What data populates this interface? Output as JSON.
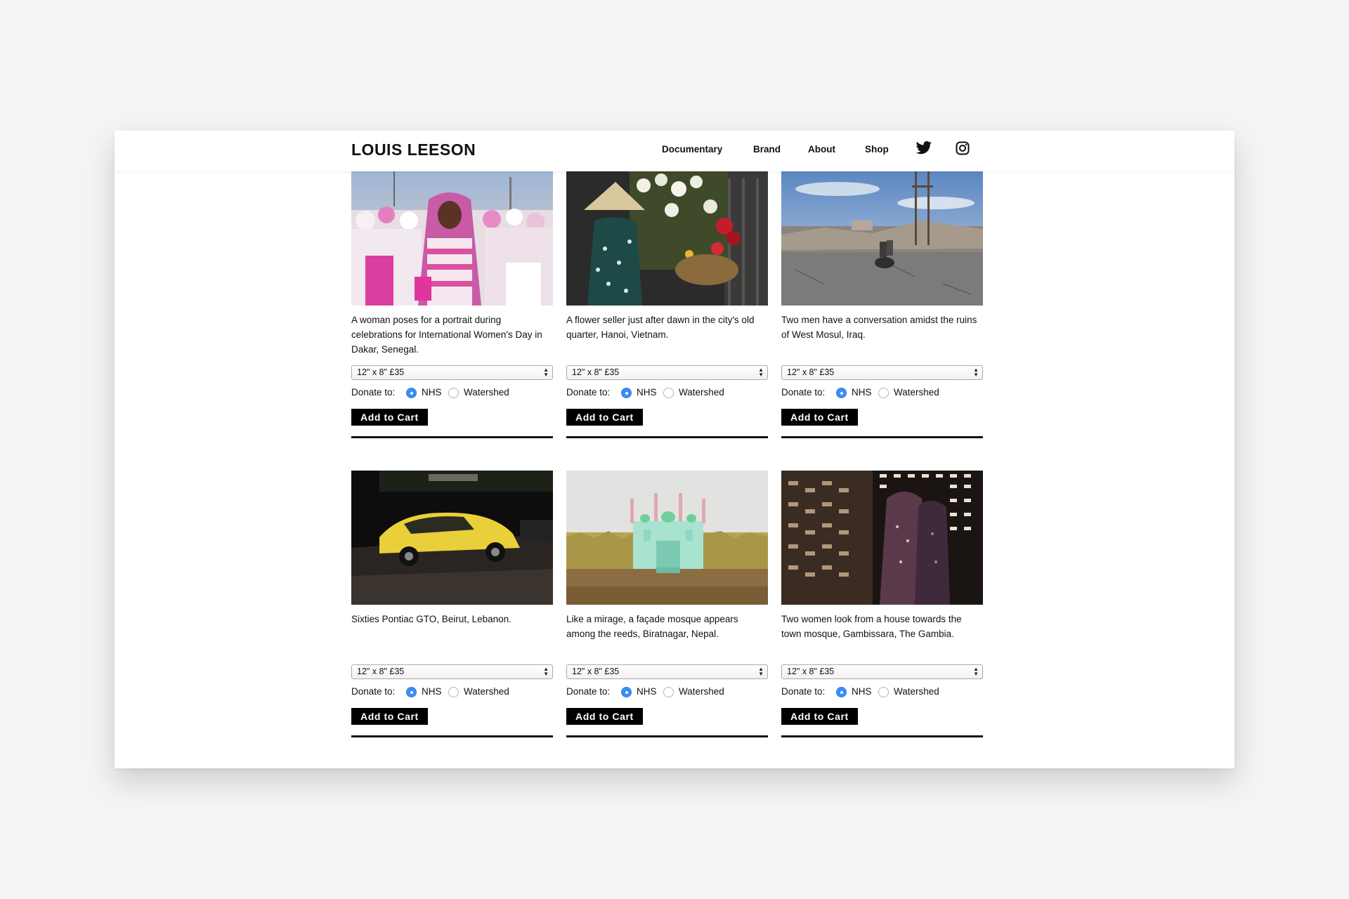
{
  "site": {
    "logo": "LOUIS LEESON"
  },
  "nav": {
    "items": [
      {
        "label": "Documentary"
      },
      {
        "label": "Brand"
      },
      {
        "label": "About"
      },
      {
        "label": "Shop"
      }
    ],
    "icons": [
      "twitter-icon",
      "instagram-icon"
    ]
  },
  "products": [
    {
      "caption": "A woman poses for a portrait during celebrations for International Women's Day in Dakar, Senegal.",
      "size_option": "12\" x 8\" £35",
      "donate_label": "Donate to:",
      "charities": [
        "NHS",
        "Watershed"
      ],
      "selected_charity": "NHS",
      "cart_label": "Add to Cart"
    },
    {
      "caption": "A flower seller just after dawn in the city's old quarter, Hanoi, Vietnam.",
      "size_option": "12\" x 8\" £35",
      "donate_label": "Donate to:",
      "charities": [
        "NHS",
        "Watershed"
      ],
      "selected_charity": "NHS",
      "cart_label": "Add to Cart"
    },
    {
      "caption": "Two men have a conversation amidst the ruins of West Mosul, Iraq.",
      "size_option": "12\" x 8\" £35",
      "donate_label": "Donate to:",
      "charities": [
        "NHS",
        "Watershed"
      ],
      "selected_charity": "NHS",
      "cart_label": "Add to Cart"
    },
    {
      "caption": "Sixties Pontiac GTO, Beirut, Lebanon.",
      "size_option": "12\" x 8\" £35",
      "donate_label": "Donate to:",
      "charities": [
        "NHS",
        "Watershed"
      ],
      "selected_charity": "NHS",
      "cart_label": "Add to Cart"
    },
    {
      "caption": "Like a mirage, a façade mosque appears among the reeds, Biratnagar, Nepal.",
      "size_option": "12\" x 8\" £35",
      "donate_label": "Donate to:",
      "charities": [
        "NHS",
        "Watershed"
      ],
      "selected_charity": "NHS",
      "cart_label": "Add to Cart"
    },
    {
      "caption": "Two women look from a house towards the town mosque, Gambissara, The Gambia.",
      "size_option": "12\" x 8\" £35",
      "donate_label": "Donate to:",
      "charities": [
        "NHS",
        "Watershed"
      ],
      "selected_charity": "NHS",
      "cart_label": "Add to Cart"
    }
  ],
  "colors": {
    "page_bg": "#f3f4f6",
    "button_bg": "#000000",
    "radio_selected": "#3b8ef5"
  }
}
